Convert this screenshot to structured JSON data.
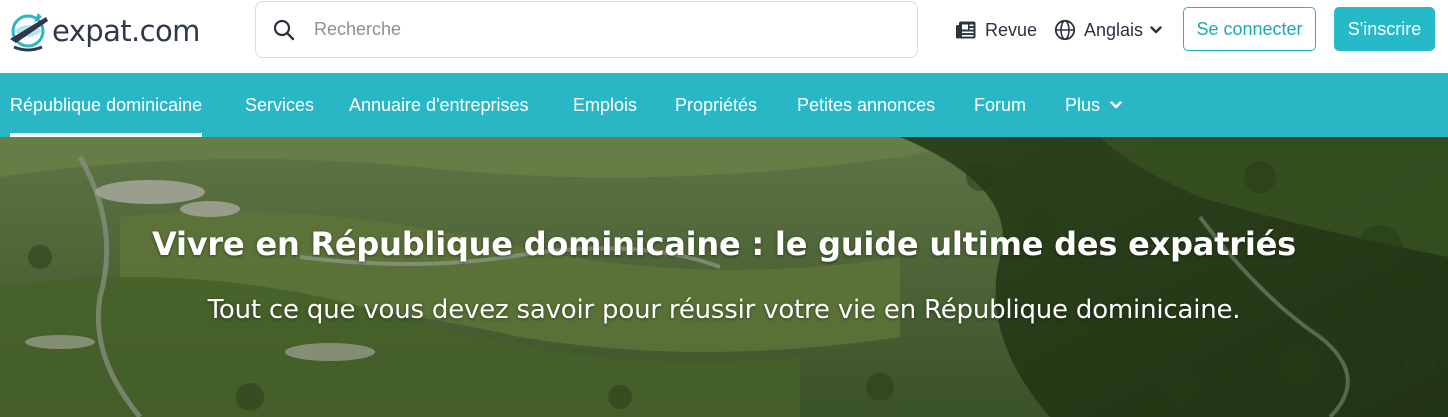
{
  "logo": {
    "text": "expat.com",
    "mark": "globe-plane-logo"
  },
  "search": {
    "placeholder": "Recherche",
    "value": "",
    "icon": "search-icon"
  },
  "header_links": {
    "revue": {
      "label": "Revue",
      "icon": "newspaper-icon"
    },
    "language": {
      "label": "Anglais",
      "icon": "globe-icon",
      "chevron": "chevron-down-icon"
    }
  },
  "buttons": {
    "login": "Se connecter",
    "signup": "S'inscrire"
  },
  "nav": {
    "items": [
      {
        "label": "République dominicaine",
        "active": true
      },
      {
        "label": "Services",
        "active": false
      },
      {
        "label": "Annuaire d'entreprises",
        "active": false
      },
      {
        "label": "Emplois",
        "active": false
      },
      {
        "label": "Propriétés",
        "active": false
      },
      {
        "label": "Petites annonces",
        "active": false
      },
      {
        "label": "Forum",
        "active": false
      },
      {
        "label": "Plus",
        "active": false
      }
    ]
  },
  "hero": {
    "title": "Vivre en République dominicaine : le guide ultime des expatriés",
    "subtitle": "Tout ce que vous devez savoir pour réussir votre vie en République dominicaine."
  },
  "colors": {
    "brand_teal": "#29b7c6",
    "logo_navy": "#2e3a4c",
    "text_dark": "#2b3340",
    "white": "#ffffff"
  }
}
